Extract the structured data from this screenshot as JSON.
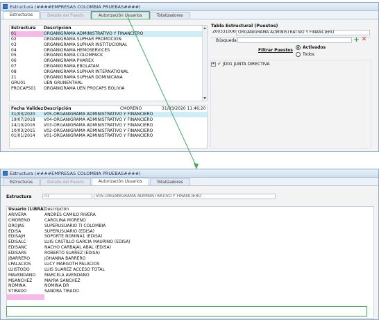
{
  "top_window": {
    "title": "Estructura (####EMPRESAS COLOMBIA PRUEBAS####)",
    "tabs": [
      "Estructuras",
      "Detalle del Puesto",
      "Autorización Usuarios",
      "Totalizadores"
    ],
    "estructuras_table": {
      "headers": [
        "Estructura",
        "Descripción"
      ],
      "rows": [
        [
          "01",
          "ORGANIGRAMA ADMINISTRATIVO Y FINANCIERO"
        ],
        [
          "02",
          "ORGANIGRAMA SUPHAR PROMOCIÓN"
        ],
        [
          "03",
          "ORGANIGRAMA SUPHAR INSTITUCIONAL"
        ],
        [
          "04",
          "ORGANIGRAMA HEMOSERVICES"
        ],
        [
          "05",
          "ORGANIGRAMA COLOMPACK"
        ],
        [
          "06",
          "ORGANIGRAMA PHAREX"
        ],
        [
          "07",
          "ORGANIGRAMA EBOLATAM"
        ],
        [
          "08",
          "ORGANIGRAMA SUPHAR INTERNATIONAL"
        ],
        [
          "21",
          "ORGANIGRAMA SUPHAR DOMINICANA"
        ],
        [
          "GRU01",
          "UEN GRUNENTHAL"
        ],
        [
          "PROCAPS01",
          "ORGANIGRAMA UEN PROCAPS BOLIVIA"
        ]
      ]
    },
    "validity_table": {
      "headers": [
        "Fecha  Validez",
        "Descripción"
      ],
      "user": "CMORENO",
      "timestamp": "31/03/2020 11:46:20",
      "rows": [
        [
          "31/03/2020",
          "V05-ORGANIGRAMA ADMINISTRATIVO Y FINANCIERO"
        ],
        [
          "19/07/2018",
          "V04-ORGANIGRAMA ADMINISTRATIVO Y FINANCIERO"
        ],
        [
          "24/10/2016",
          "V03-ORGANIGRAMA ADMINISTRATIVO Y FINANCIERO"
        ],
        [
          "10/03/2015",
          "V02-ORGANIGRAMA ADMINISTRATIVO Y FINANCIERO"
        ],
        [
          "01/01/2014",
          "V01-ORGANIGRAMA ADMINISTRATIVO Y FINANCIERO"
        ]
      ]
    },
    "tabla_estructural": {
      "label": "Tabla Estructural (Puestos)",
      "code": "2003310060",
      "description": "ORGANIGRAMA ADMINISTRATIVO Y FINANCIERO",
      "busqueda_label": "Búsqueda",
      "filtrar_label": "Filtrar Puestos",
      "radio_activados": "Activados",
      "radio_todos": "Todos",
      "tree_item": "JD01 JUNTA DIRECTIVA"
    }
  },
  "bottom_window": {
    "title": "Estructura (####EMPRESAS COLOMBIA PRUEBAS####)",
    "tabs": [
      "Estructuras",
      "Detalle del Puesto",
      "Autorización Usuarios",
      "Totalizadores"
    ],
    "estructura_label": "Estructura",
    "estructura_code": "01",
    "estructura_desc": "V05-ORGANIGRAMA ADMINISTRATIVO Y FINANCIERO",
    "users_table": {
      "headers": [
        "Usuario (LIBRA)",
        "Descripción"
      ],
      "rows": [
        [
          "ARIVERA",
          "ANDRES CAMILO RIVERA"
        ],
        [
          "CMORENO",
          "CAROLINA MORENO"
        ],
        [
          "DROJAS",
          "SUPERUSUARIO TI COLOMBIA"
        ],
        [
          "EDISA",
          "SUPERUSUARIO (EDISA)"
        ],
        [
          "EDISAJH",
          "SOPORTE NOMINA1 (EDISA)"
        ],
        [
          "EDISALC",
          "LUIS CASTILLO GARCIA MAURIÑO (EDISA)"
        ],
        [
          "EDISANC",
          "NACHO CARBAJAL ABAL (EDISA)"
        ],
        [
          "EDISARS",
          "ROBERTO SUAREZ (EDISA)"
        ],
        [
          "JBARRERO",
          "JOHANNA BARRERO"
        ],
        [
          "LPALACIOS",
          "LUCY MARGOTH PALACIOS"
        ],
        [
          "LUISTODO",
          "LUIS SUAREZ ACCESO TOTAL"
        ],
        [
          "MAVENDANO",
          "MARCELA AVENDAÑO"
        ],
        [
          "MSANCHEZ",
          "MAYRA SANCHEZ"
        ],
        [
          "NOMINA",
          "NOMINA DR"
        ],
        [
          "STIRADO",
          "SANDRA TIRADO"
        ]
      ]
    }
  },
  "colors": {
    "highlight": "#3fae5b",
    "pink": "#f7b9e8",
    "selection": "#cdeef5"
  }
}
